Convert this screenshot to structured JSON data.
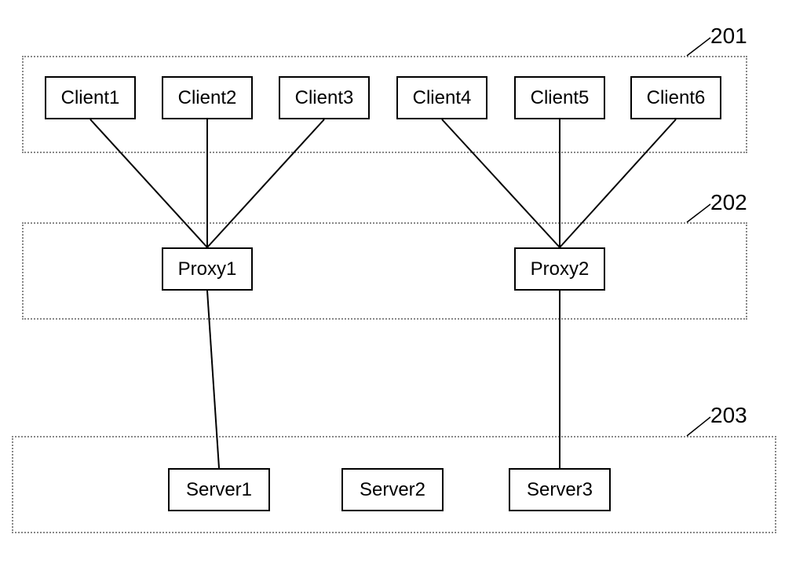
{
  "layers": {
    "clients_label": "201",
    "proxies_label": "202",
    "servers_label": "203"
  },
  "clients": [
    {
      "label": "Client1"
    },
    {
      "label": "Client2"
    },
    {
      "label": "Client3"
    },
    {
      "label": "Client4"
    },
    {
      "label": "Client5"
    },
    {
      "label": "Client6"
    }
  ],
  "proxies": [
    {
      "label": "Proxy1"
    },
    {
      "label": "Proxy2"
    }
  ],
  "servers": [
    {
      "label": "Server1"
    },
    {
      "label": "Server2"
    },
    {
      "label": "Server3"
    }
  ]
}
